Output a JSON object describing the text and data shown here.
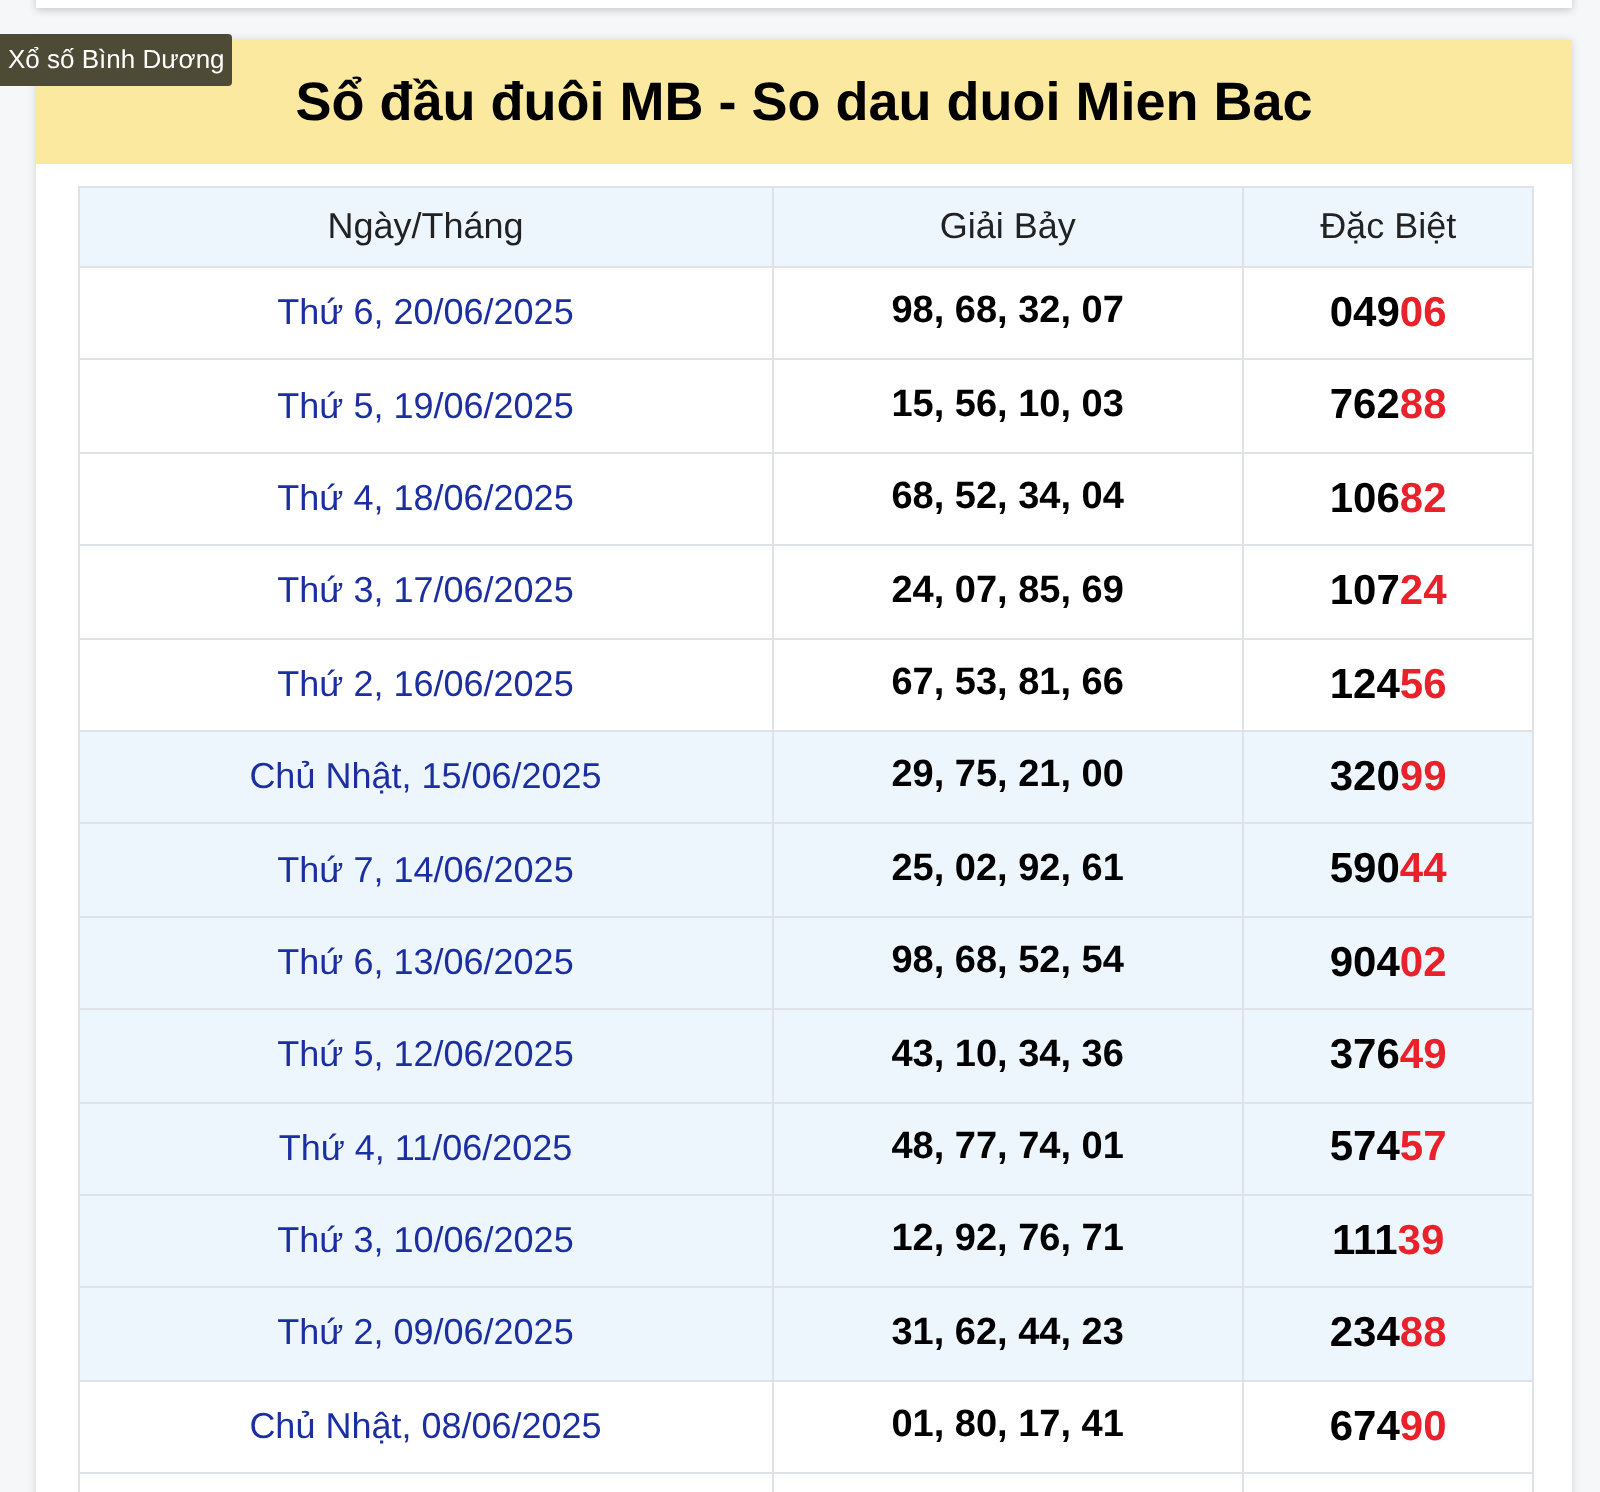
{
  "tooltip": "Xổ số Bình Dương",
  "title": "Sổ đầu đuôi MB - So dau duoi Mien Bac",
  "table": {
    "columns": [
      "Ngày/Tháng",
      "Giải Bảy",
      "Đặc Biệt"
    ],
    "rows": [
      {
        "date": "Thứ 6, 20/06/2025",
        "prize7": "98, 68, 32, 07",
        "special_head": "049",
        "special_tail": "06",
        "shaded": false
      },
      {
        "date": "Thứ 5, 19/06/2025",
        "prize7": "15, 56, 10, 03",
        "special_head": "762",
        "special_tail": "88",
        "shaded": false
      },
      {
        "date": "Thứ 4, 18/06/2025",
        "prize7": "68, 52, 34, 04",
        "special_head": "106",
        "special_tail": "82",
        "shaded": false
      },
      {
        "date": "Thứ 3, 17/06/2025",
        "prize7": "24, 07, 85, 69",
        "special_head": "107",
        "special_tail": "24",
        "shaded": false
      },
      {
        "date": "Thứ 2, 16/06/2025",
        "prize7": "67, 53, 81, 66",
        "special_head": "124",
        "special_tail": "56",
        "shaded": false
      },
      {
        "date": "Chủ Nhật, 15/06/2025",
        "prize7": "29, 75, 21, 00",
        "special_head": "320",
        "special_tail": "99",
        "shaded": true
      },
      {
        "date": "Thứ 7, 14/06/2025",
        "prize7": "25, 02, 92, 61",
        "special_head": "590",
        "special_tail": "44",
        "shaded": true
      },
      {
        "date": "Thứ 6, 13/06/2025",
        "prize7": "98, 68, 52, 54",
        "special_head": "904",
        "special_tail": "02",
        "shaded": true
      },
      {
        "date": "Thứ 5, 12/06/2025",
        "prize7": "43, 10, 34, 36",
        "special_head": "376",
        "special_tail": "49",
        "shaded": true
      },
      {
        "date": "Thứ 4, 11/06/2025",
        "prize7": "48, 77, 74, 01",
        "special_head": "574",
        "special_tail": "57",
        "shaded": true
      },
      {
        "date": "Thứ 3, 10/06/2025",
        "prize7": "12, 92, 76, 71",
        "special_head": "111",
        "special_tail": "39",
        "shaded": true
      },
      {
        "date": "Thứ 2, 09/06/2025",
        "prize7": "31, 62, 44, 23",
        "special_head": "234",
        "special_tail": "88",
        "shaded": true
      },
      {
        "date": "Chủ Nhật, 08/06/2025",
        "prize7": "01, 80, 17, 41",
        "special_head": "674",
        "special_tail": "90",
        "shaded": false
      }
    ]
  }
}
